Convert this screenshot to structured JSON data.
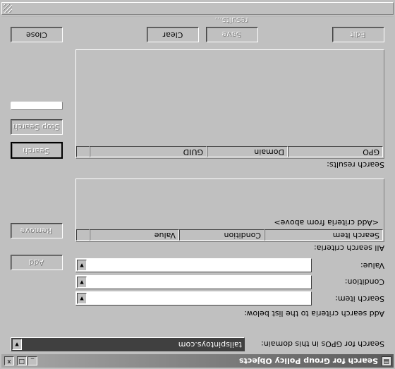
{
  "window": {
    "title": "Search for Group Policy Objects",
    "controls": {
      "minimize": "_",
      "maximize": "□",
      "close": "x"
    }
  },
  "domain_label": "Search for GPOs in this domain:",
  "domain_value": "tailspintoys.com",
  "add_criteria_label": "Add search criteria to the list below:",
  "search_item_label": "Search item:",
  "condition_label": "Condition:",
  "value_label": "Value:",
  "add_button": "Add",
  "all_criteria_label": "All search criteria:",
  "criteria_list": {
    "columns": [
      "Search Item",
      "Condition",
      "Value"
    ],
    "placeholder": "<Add criteria from above>"
  },
  "remove_button": "Remove",
  "results_label": "Search results:",
  "results_list": {
    "columns": [
      "GPO",
      "Domain",
      "GUID"
    ]
  },
  "search_button": "Search",
  "stop_button": "Stop Search",
  "bottom_buttons": {
    "edit": "Edit",
    "save": "Save results...",
    "clear": "Clear",
    "close": "Close"
  }
}
